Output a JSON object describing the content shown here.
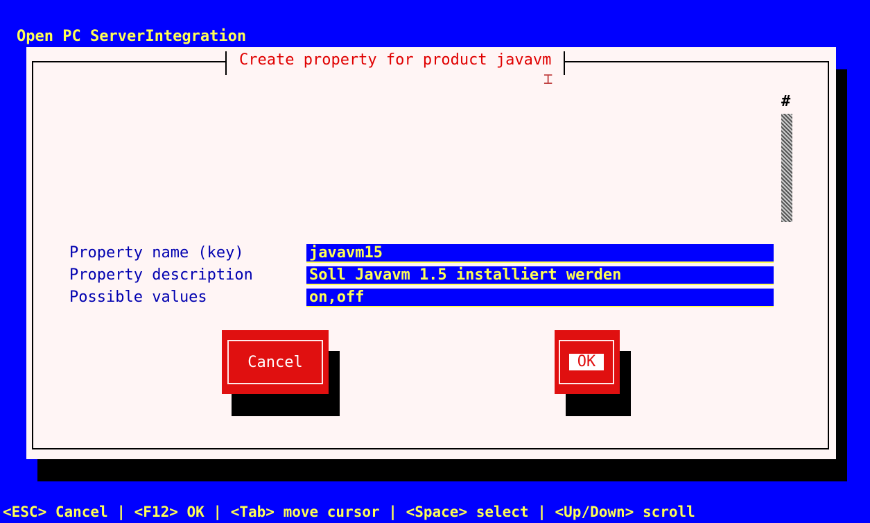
{
  "app": {
    "title": "Open PC ServerIntegration"
  },
  "dialog": {
    "title": "Create property for product javavm",
    "scroll_marker": "#",
    "fields": [
      {
        "label": "Property name (key)",
        "value": "javavm15"
      },
      {
        "label": "Property description",
        "value": "Soll Javavm 1.5 installiert werden"
      },
      {
        "label": "Possible values",
        "value": "on,off"
      }
    ],
    "buttons": {
      "cancel": "Cancel",
      "ok": "OK"
    }
  },
  "hint_bar": {
    "text": "<ESC> Cancel | <F12> OK | <Tab> move cursor | <Space> select | <Up/Down> scroll"
  },
  "colors": {
    "background": "#0000ff",
    "dialog": "#fff5f5",
    "accent": "#e01010",
    "highlight_text": "#ffff54"
  }
}
